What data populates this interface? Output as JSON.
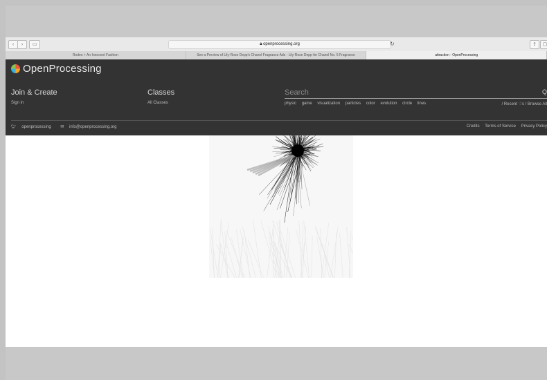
{
  "browser": {
    "url": "openprocessing.org",
    "back_icon": "chevron-left-icon",
    "forward_icon": "chevron-right-icon",
    "tabs": [
      {
        "label": "Rodeo + An Innocent Fashion"
      },
      {
        "label": "See a Preview of Lily-Rose Depp's Chanel Fragrance Ads - Lily-Rose Depp for Chanel No. 5 Fragrance"
      },
      {
        "label": "attraction - OpenProcessing"
      }
    ]
  },
  "header": {
    "logo_text": "OpenProcessing",
    "join_title": "Join & Create",
    "signin_label": "Sign in",
    "classes_title": "Classes",
    "all_classes_label": "All Classes",
    "search_placeholder": "Search",
    "tags": [
      "physic",
      "game",
      "visualization",
      "particles",
      "color",
      "evolution",
      "circle",
      "lines"
    ],
    "browse_text": "/ Recent ♡s  / Browse All",
    "twitter_label": "openprocessing",
    "email_label": "info@openprocessing.org",
    "credits_label": "Credits",
    "terms_label": "Terms of Service",
    "privacy_label": "Privacy Policy"
  },
  "sketch": {
    "line_color": "#000000",
    "background": "#f7f7f7"
  }
}
